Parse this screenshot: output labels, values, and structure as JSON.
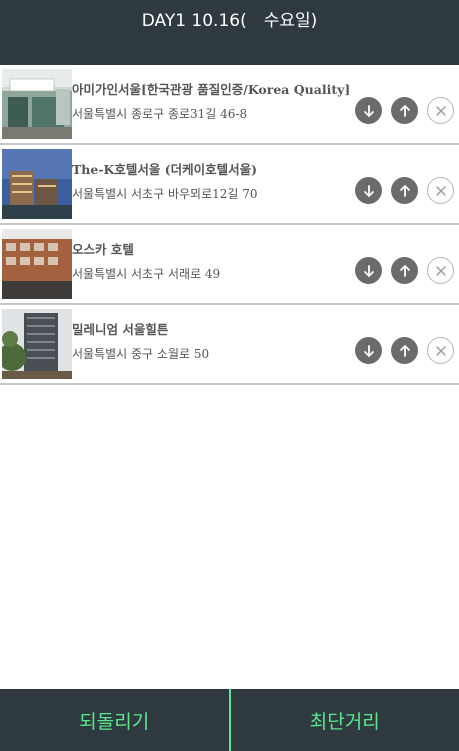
{
  "header": {
    "title": "DAY1 10.16(　수요일)"
  },
  "items": [
    {
      "name": "아미가인서울[한국관광 품질인증/Korea Quality]",
      "address": "서울특별시 종로구 종로31길 46-8"
    },
    {
      "name": "The-K호텔서울 (더케이호텔서울)",
      "address": "서울특별시 서초구 바우뫼로12길 70"
    },
    {
      "name": "오스카 호텔",
      "address": "서울특별시 서초구 서래로 49"
    },
    {
      "name": "밀레니엄 서울힐튼",
      "address": "서울특별시 중구 소월로 50"
    }
  ],
  "icons": {
    "down": "arrow-down-icon",
    "up": "arrow-up-icon",
    "remove": "close-icon"
  },
  "footer": {
    "undo_label": "되돌리기",
    "shortest_label": "최단거리"
  },
  "colors": {
    "header_bg": "#2e3a40",
    "footer_text": "#5ce88a",
    "button_fill": "#6b6b6b"
  }
}
